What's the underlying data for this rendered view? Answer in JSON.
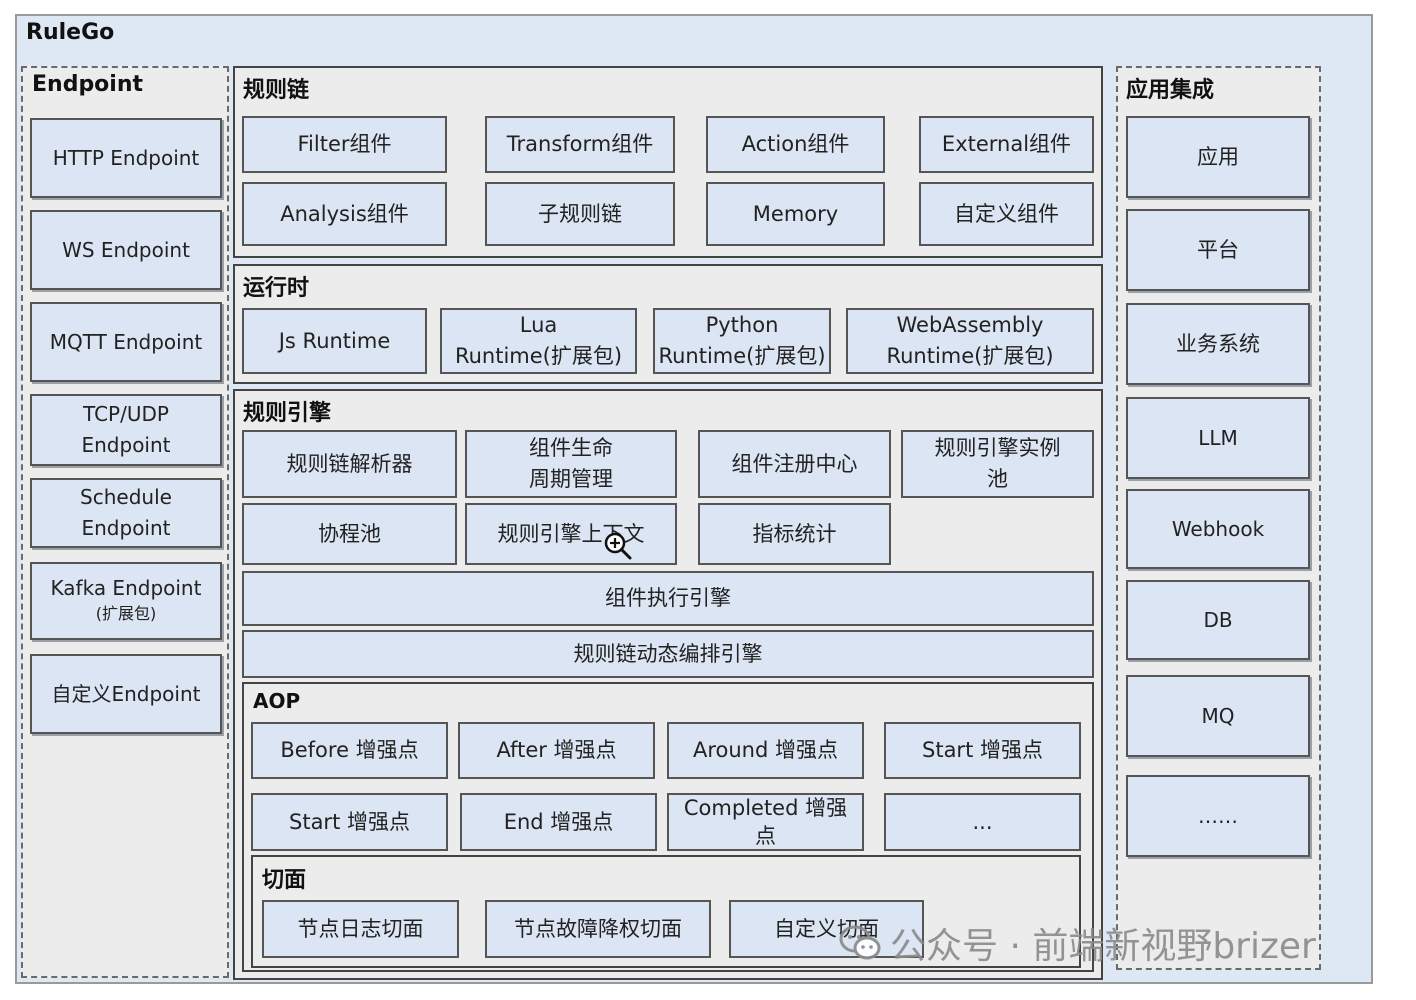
{
  "title": "RuleGo",
  "endpoint": {
    "title": "Endpoint",
    "items": [
      "HTTP Endpoint",
      "WS Endpoint",
      "MQTT Endpoint",
      "TCP/UDP\nEndpoint",
      "Schedule\nEndpoint",
      "Kafka Endpoint",
      "自定义Endpoint"
    ],
    "kafka_note": "(扩展包)"
  },
  "rule_chain": {
    "title": "规则链",
    "items": [
      "Filter组件",
      "Transform组件",
      "Action组件",
      "External组件",
      "Analysis组件",
      "子规则链",
      "Memory",
      "自定义组件"
    ]
  },
  "runtime": {
    "title": "运行时",
    "items": [
      "Js Runtime",
      "Lua\nRuntime(扩展包)",
      "Python\nRuntime(扩展包)",
      "WebAssembly\nRuntime(扩展包)"
    ]
  },
  "engine": {
    "title": "规则引擎",
    "items": [
      "规则链解析器",
      "组件生命\n周期管理",
      "组件注册中心",
      "规则引擎实例\n池",
      "协程池",
      "规则引擎上下文",
      "指标统计"
    ],
    "exec": "组件执行引擎",
    "orchestration": "规则链动态编排引擎"
  },
  "aop": {
    "title": "AOP",
    "items": [
      "Before 增强点",
      "After 增强点",
      "Around 增强点",
      "Start 增强点",
      "Start 增强点",
      "End 增强点",
      "Completed 增强\n点",
      "..."
    ],
    "aspect": {
      "title": "切面",
      "items": [
        "节点日志切面",
        "节点故障降权切面",
        "自定义切面"
      ]
    }
  },
  "integration": {
    "title": "应用集成",
    "items": [
      "应用",
      "平台",
      "业务系统",
      "LLM",
      "Webhook",
      "DB",
      "MQ",
      "……"
    ]
  },
  "watermark": "公众号 · 前端新视野brizer",
  "icons": [
    "zoom-in-icon",
    "wechat-logo-icon"
  ]
}
